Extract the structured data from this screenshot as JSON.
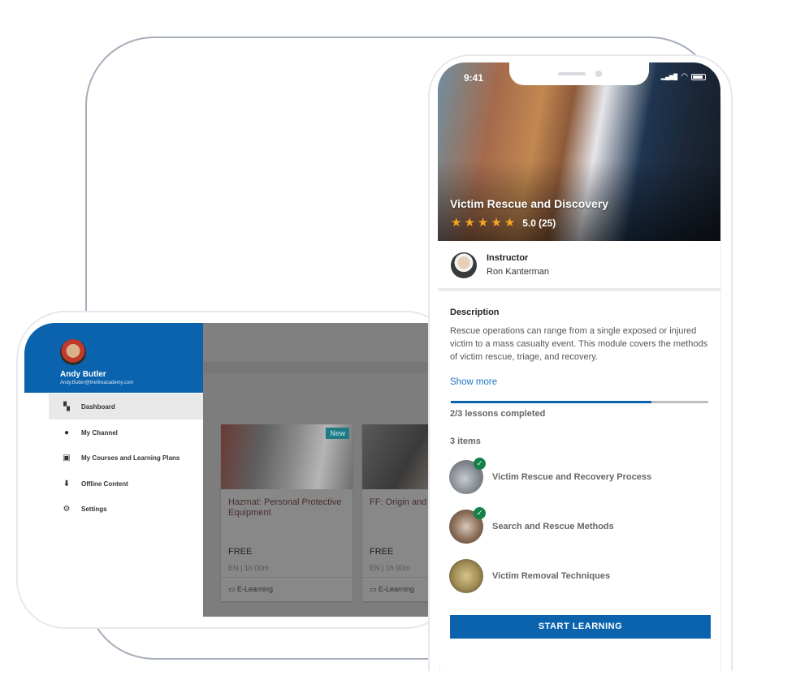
{
  "landscape_app": {
    "user": {
      "name": "Andy Butler",
      "email": "Andy.Butler@thefireacademy.com"
    },
    "menu": [
      {
        "label": "Dashboard",
        "icon": "dashboard-icon",
        "glyph": "▚",
        "active": true
      },
      {
        "label": "My Channel",
        "icon": "person-icon",
        "glyph": "👤",
        "active": false
      },
      {
        "label": "My Courses and Learning Plans",
        "icon": "briefcase-icon",
        "glyph": "▣",
        "active": false
      },
      {
        "label": "Offline Content",
        "icon": "download-icon",
        "glyph": "⬇",
        "active": false
      },
      {
        "label": "Settings",
        "icon": "gear-icon",
        "glyph": "⚙",
        "active": false
      }
    ],
    "cards": [
      {
        "title": "Hazmat: Personal Protective Equipment",
        "badge": "New",
        "price": "FREE",
        "language": "EN",
        "separator": "|",
        "duration": "1h 00m",
        "type": "E-Learning",
        "type_icon": "▭"
      },
      {
        "title": "FF: Origin and Investigation",
        "badge": "",
        "price": "FREE",
        "language": "EN",
        "separator": "|",
        "duration": "1h 00m",
        "type": "E-Learning",
        "type_icon": "▭"
      }
    ]
  },
  "portrait_app": {
    "status_bar": {
      "time": "9:41",
      "signal": "▂▄▆█",
      "wifi": "◠"
    },
    "course": {
      "title": "Victim Rescue and Discovery",
      "rating": "5.0",
      "rating_count": "(25)",
      "stars": 5,
      "star_glyph": "★"
    },
    "instructor": {
      "label": "Instructor",
      "name": "Ron Kanterman"
    },
    "description": {
      "title": "Description",
      "text": "Rescue operations can range from a single exposed or injured victim to a mass casualty event. This module covers the methods of victim rescue, triage, and recovery.",
      "show_more": "Show more"
    },
    "progress": {
      "completed": 2,
      "total": 3,
      "fraction": 0.78,
      "label": "2/3 lessons completed"
    },
    "items_count": "3 items",
    "lessons": [
      {
        "name": "Victim Rescue and Recovery Process",
        "completed": true
      },
      {
        "name": "Search and Rescue Methods",
        "completed": true
      },
      {
        "name": "Victim Removal Techniques",
        "completed": false
      }
    ],
    "check_glyph": "✓",
    "start_button": "START LEARNING"
  },
  "colors": {
    "brand_blue": "#0b63ad",
    "link_blue": "#1f74c6",
    "check_green": "#14804a",
    "star_gold": "#f5a623"
  }
}
